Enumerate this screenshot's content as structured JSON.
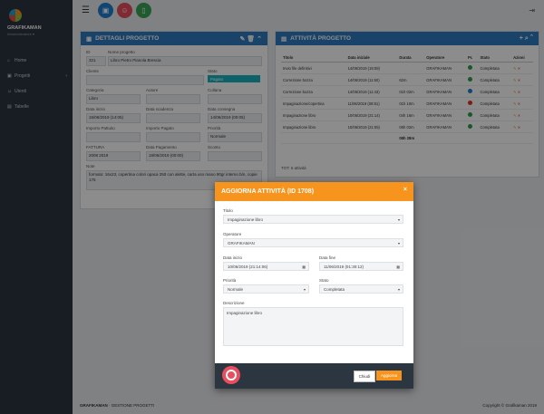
{
  "sidebar": {
    "brand": "GRAFIKAMAN",
    "brand_sub": "Amministratore ▾",
    "items": [
      {
        "label": "Home"
      },
      {
        "label": "Progetti"
      },
      {
        "label": "Utenti"
      },
      {
        "label": "Tabelle"
      }
    ]
  },
  "dettagli": {
    "title": "DETTAGLI PROGETTO",
    "id_label": "ID",
    "id_value": "321",
    "nome_label": "Nome progetto",
    "nome_value": "Libro Pietro Pianola Brescia",
    "cliente_label": "Cliente",
    "stato_label": "Stato",
    "stato_value": "Pagato",
    "categoria_label": "Categoria",
    "categoria_value": "Libro",
    "autore_label": "Autore",
    "collana_label": "Collana",
    "data_inizio_label": "Data inizio",
    "data_inizio_value": "15/06/2019 (14:05)",
    "data_scadenza_label": "Data scadenza",
    "data_consegna_label": "Data consegna",
    "data_consegna_value": "14/06/2019 (00:05)",
    "importo_label": "Importo Pattuito",
    "importo_pagato_label": "Importo Pagato",
    "priorita_label": "Priorità",
    "priorita_value": "Normale",
    "fattura_label": "FATTURA",
    "fattura_value": "2008 2019",
    "data_pagamento_label": "Data Pagamento",
    "data_pagamento_value": "18/06/2019 (00:00)",
    "sconto_label": "Sconto",
    "note_label": "Note",
    "note_value": "formato: 16x23, copertina colori opaca 250 con alette, carta uso mano 90gr interno b/n, copie 175"
  },
  "attivita": {
    "title": "ATTIVITÀ PROGETTO",
    "columns": [
      "Titolo",
      "Data iniziale",
      "Durata",
      "Operatore",
      "Pr.",
      "Stato",
      "Azioni"
    ],
    "rows": [
      {
        "titolo": "Invio file definitivi",
        "data": "14/06/2019 (19:08)",
        "durata": "",
        "operatore": "GRAFIKAMAN",
        "pr": "#2e9e4f",
        "stato": "Completata"
      },
      {
        "titolo": "Correzione bozza",
        "data": "14/06/2019 (11:50)",
        "durata": "62m",
        "operatore": "GRAFIKAMAN",
        "pr": "#2e9e4f",
        "stato": "Completata"
      },
      {
        "titolo": "Correzione bozza",
        "data": "14/06/2019 (11:43)",
        "durata": "01h 02m",
        "operatore": "GRAFIKAMAN",
        "pr": "#1f7fd0",
        "stato": "Completata"
      },
      {
        "titolo": "Impaginazione/copertina",
        "data": "11/06/2019 (08:51)",
        "durata": "01h 10m",
        "operatore": "GRAFIKAMAN",
        "pr": "#d9372c",
        "stato": "Completata"
      },
      {
        "titolo": "Impaginazione libro",
        "data": "10/06/2019 (21:14)",
        "durata": "04h 16m",
        "operatore": "GRAFIKAMAN",
        "pr": "#2e9e4f",
        "stato": "Completata"
      },
      {
        "titolo": "Impaginazione libro",
        "data": "10/06/2019 (21:05)",
        "durata": "06h 02m",
        "operatore": "GRAFIKAMAN",
        "pr": "#2e9e4f",
        "stato": "Completata"
      }
    ],
    "total": "08h 28m",
    "footer": "TOT: 6 attività"
  },
  "footer": {
    "left_bold": "GRAFIKAMAN",
    "left_rest": " · GESTIONE PROGETTI",
    "right": "Copyright © Grafikaman 2019"
  },
  "modal": {
    "title": "AGGIORNA ATTIVITÀ (ID 1708)",
    "close": "×",
    "titolo_label": "Titolo",
    "titolo_value": "Impaginazione libro",
    "operatore_label": "Operatore",
    "operatore_value": "GRAFIKAMAN",
    "data_inizio_label": "Data inizio",
    "data_inizio_value": "10/06/2019 (21:14:06)",
    "data_fine_label": "Data fine",
    "data_fine_value": "11/06/2019 (01:30:12)",
    "priorita_label": "Priorità",
    "priorita_value": "Normale",
    "stato_label": "Stato",
    "stato_value": "Completata",
    "descrizione_label": "Descrizione",
    "descrizione_value": "Impaginazione libro",
    "btn_chiudi": "Chiudi",
    "btn_aggiorna": "Aggiorna"
  },
  "colors": {
    "primary": "#2e7bc0",
    "orange": "#f7941d",
    "sidebar": "#2b3640",
    "teal": "#18b3c2"
  }
}
